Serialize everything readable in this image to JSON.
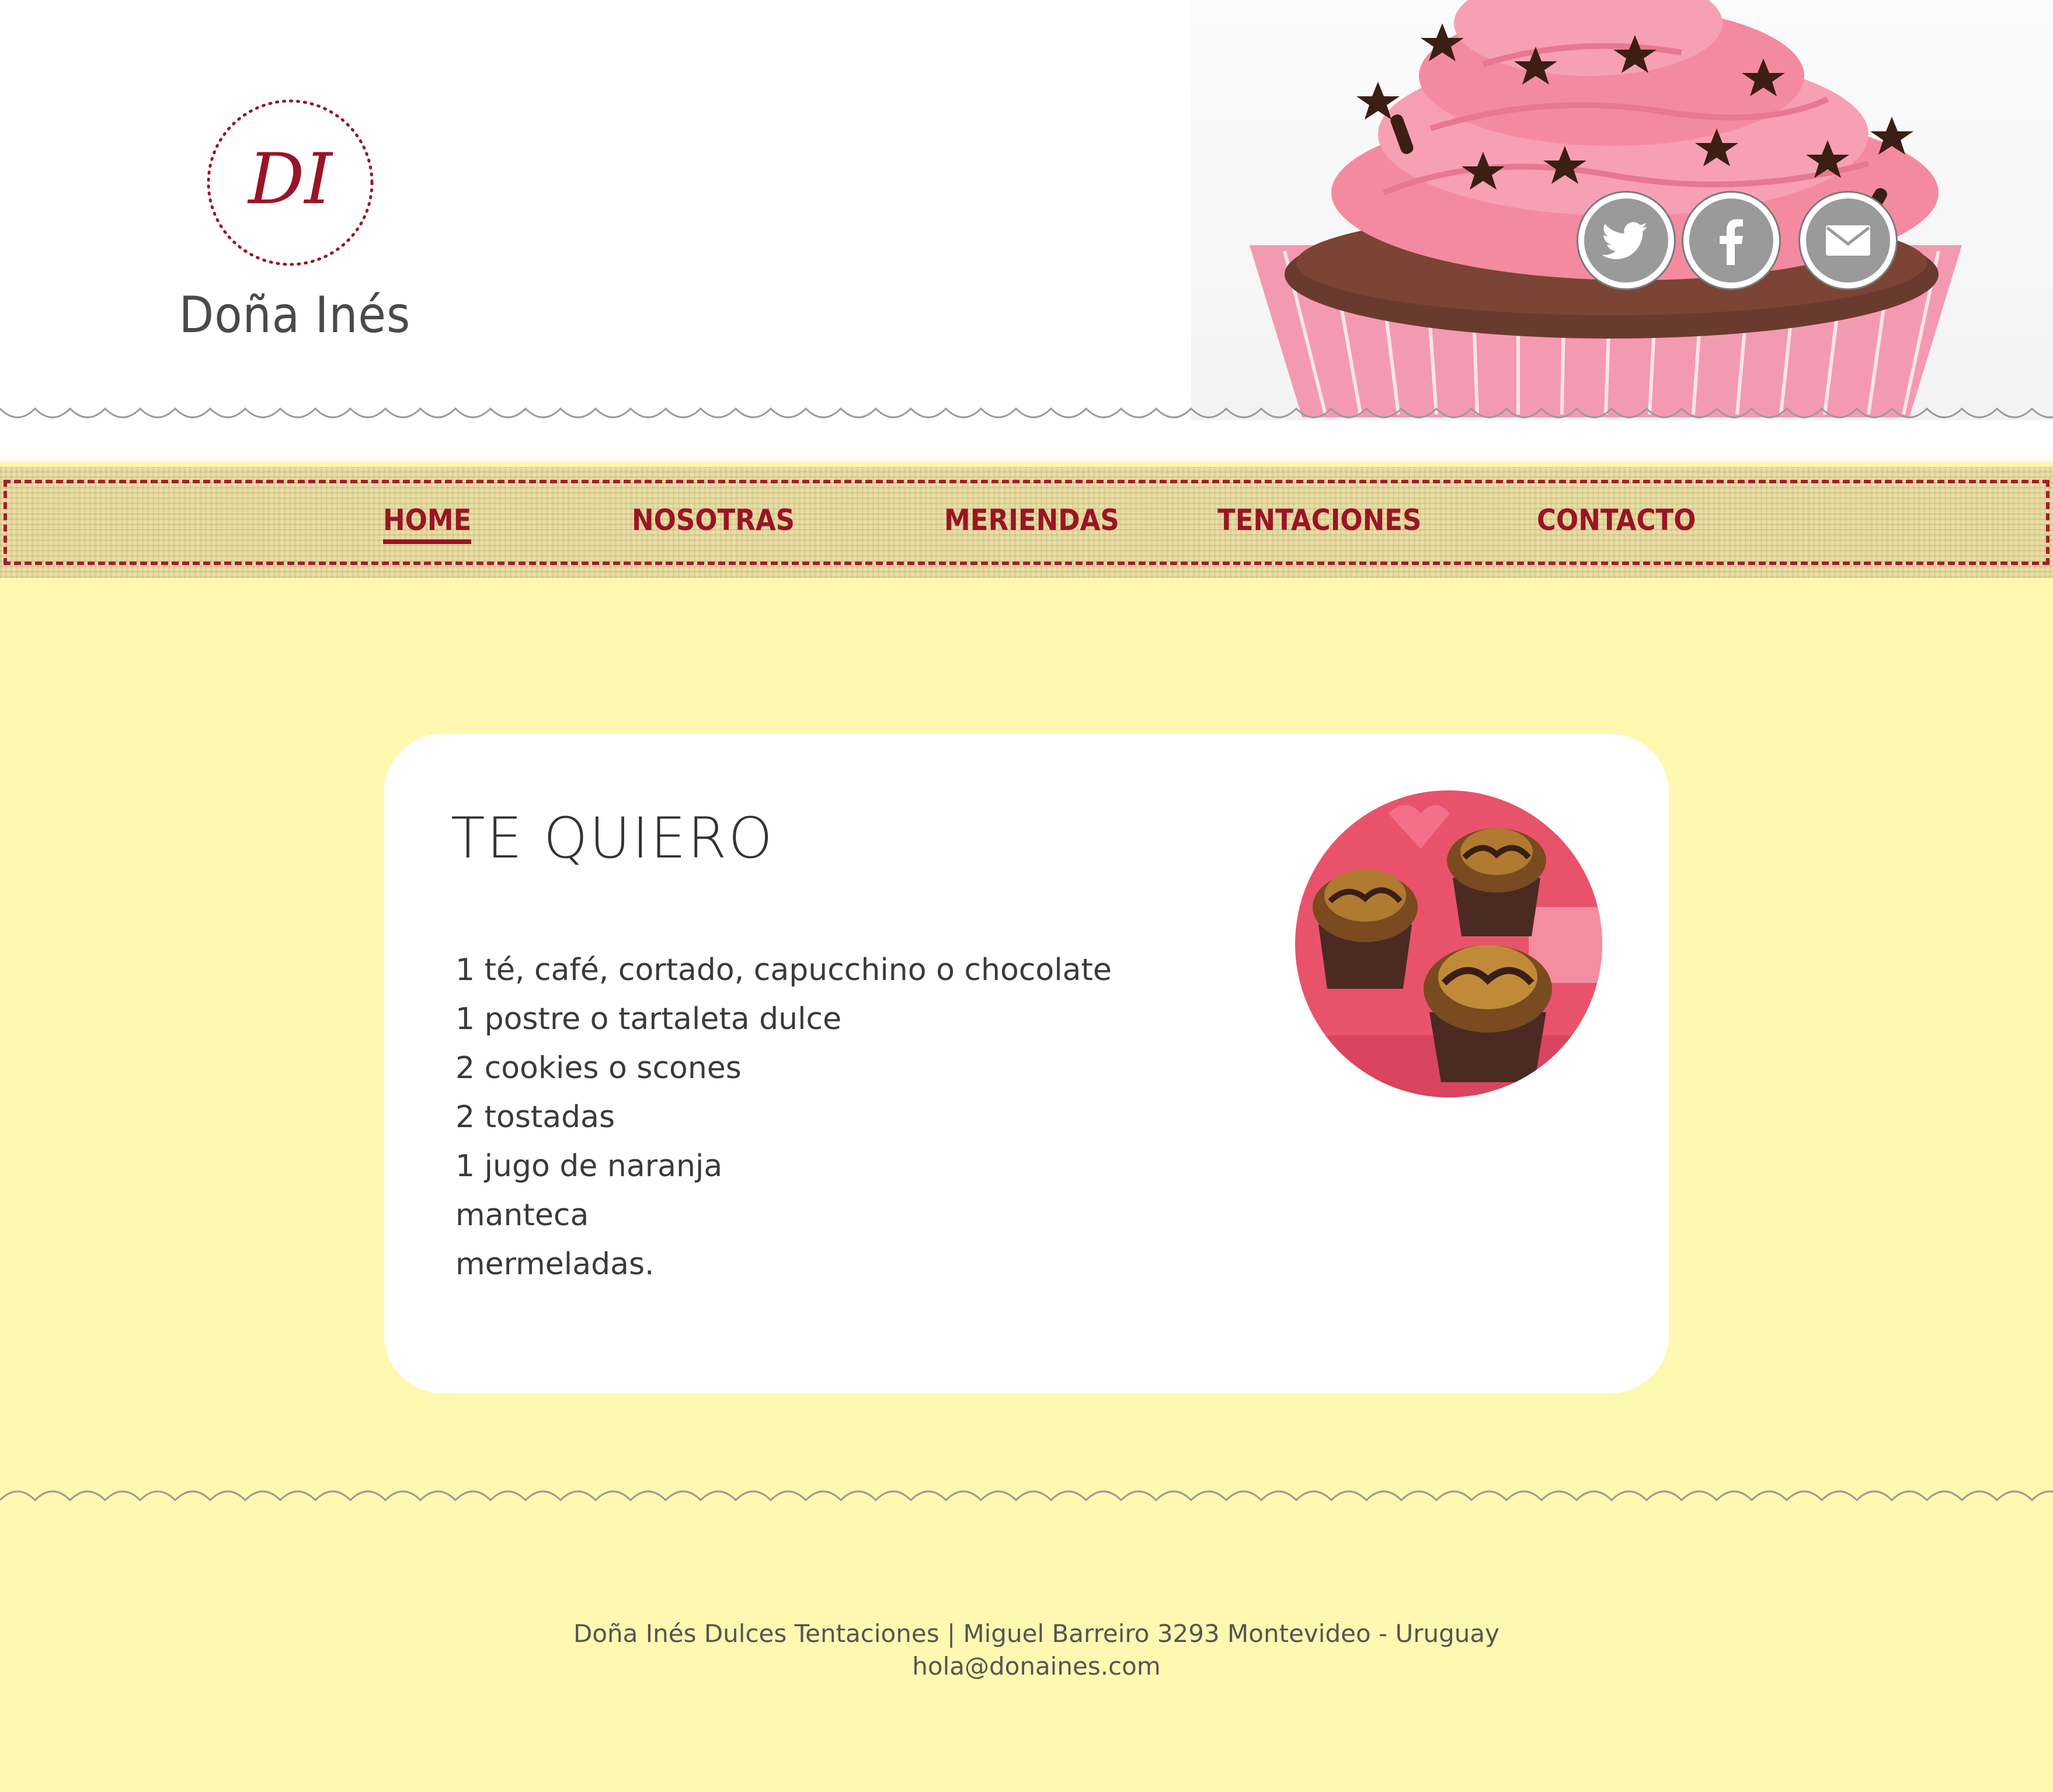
{
  "colors": {
    "brand_red": "#9a1426",
    "page_yellow": "#fef8b0",
    "ribbon_tan": "#e9dfa6",
    "frosting_pink": "#f48aa0",
    "social_gray": "#9a9a9a"
  },
  "header": {
    "logo_monogram": "DI",
    "brand_name": "Doña Inés",
    "social": [
      {
        "icon": "twitter-icon"
      },
      {
        "icon": "facebook-icon"
      },
      {
        "icon": "email-icon"
      }
    ],
    "hero_image": "cupcake-photo"
  },
  "nav": {
    "items": [
      {
        "label": "HOME",
        "active": true
      },
      {
        "label": "NOSOTRAS",
        "active": false
      },
      {
        "label": "MERIENDAS",
        "active": false
      },
      {
        "label": "TENTACIONES",
        "active": false
      },
      {
        "label": "CONTACTO",
        "active": false
      }
    ]
  },
  "card": {
    "title": "TE QUIERO",
    "items": [
      "1 té, café, cortado, capucchino o chocolate",
      "1 postre o tartaleta dulce",
      "2 cookies o scones",
      "2 tostadas",
      "1 jugo de naranja",
      "manteca",
      "mermeladas."
    ],
    "photo": "cupcakes-photo"
  },
  "footer": {
    "address": "Doña Inés Dulces Tentaciones | Miguel Barreiro  3293  Montevideo - Uruguay",
    "email": "hola@donaines.com"
  }
}
